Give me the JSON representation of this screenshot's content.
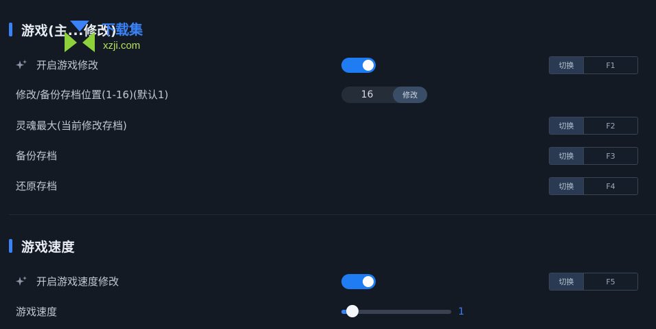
{
  "section1": {
    "title": "游戏(主...修改)"
  },
  "section2": {
    "title": "游戏速度"
  },
  "rows": [
    {
      "label": "开启游戏修改",
      "icon": "sparkle-icon",
      "toggle": true,
      "hotkey_btn": "切换",
      "hotkey_key": "F1"
    },
    {
      "label": "修改/备份存档位置(1-16)(默认1)",
      "value": "16",
      "button": "修改"
    },
    {
      "label": "灵魂最大(当前修改存档)",
      "hotkey_btn": "切换",
      "hotkey_key": "F2"
    },
    {
      "label": "备份存档",
      "hotkey_btn": "切换",
      "hotkey_key": "F3"
    },
    {
      "label": "还原存档",
      "hotkey_btn": "切换",
      "hotkey_key": "F4"
    }
  ],
  "speed_rows": [
    {
      "label": "开启游戏速度修改",
      "icon": "sparkle-icon",
      "toggle": true,
      "hotkey_btn": "切换",
      "hotkey_key": "F5"
    },
    {
      "label": "游戏速度",
      "slider_value": "1",
      "slider_fraction": 0.1
    }
  ],
  "watermark": {
    "text": "xzji.com",
    "brand": "下载集"
  },
  "colors": {
    "accent": "#3a82f6",
    "background": "#131a24",
    "toggle_on": "#1f7cf2"
  }
}
